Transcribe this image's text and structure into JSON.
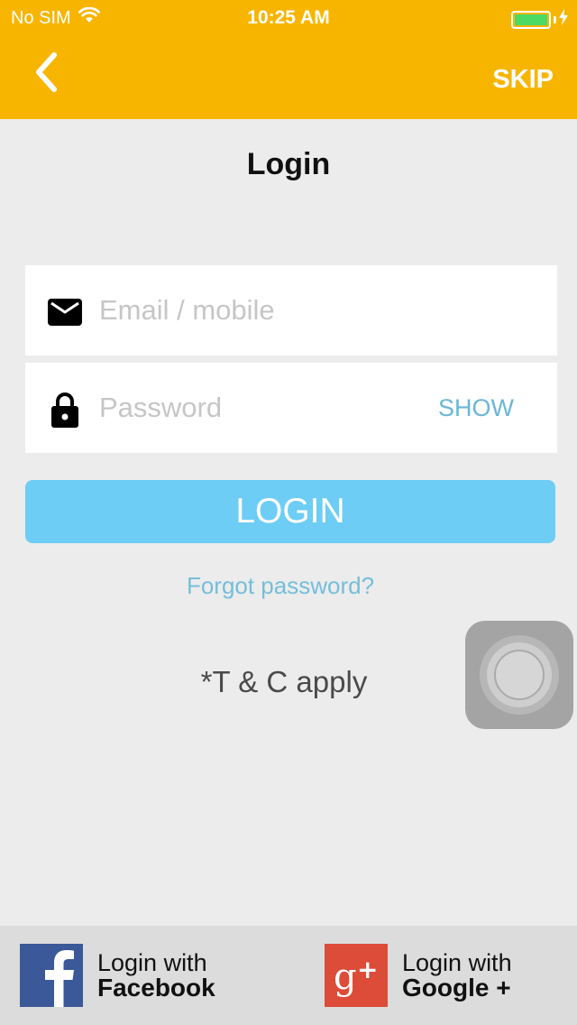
{
  "status_bar": {
    "carrier": "No SIM",
    "time": "10:25 AM",
    "battery_level": 1.0
  },
  "nav": {
    "back_icon": "chevron-left-icon",
    "skip_label": "SKIP"
  },
  "title": "Login",
  "email_field": {
    "icon": "mail-icon",
    "placeholder": "Email / mobile",
    "value": ""
  },
  "password_field": {
    "icon": "lock-icon",
    "placeholder": "Password",
    "value": "",
    "show_label": "SHOW"
  },
  "login_button": "LOGIN",
  "forgot_password": "Forgot password?",
  "terms": "*T & C apply",
  "social": {
    "facebook": {
      "icon": "facebook-icon",
      "line1": "Login with",
      "line2": "Facebook"
    },
    "google": {
      "icon": "google-plus-icon",
      "line1": "Login with",
      "line2": "Google +"
    }
  },
  "colors": {
    "header": "#f7b500",
    "login_button": "#6dcdf4",
    "link": "#75bedb",
    "facebook": "#3b5998",
    "google": "#dd4b39",
    "battery": "#4cd964"
  }
}
